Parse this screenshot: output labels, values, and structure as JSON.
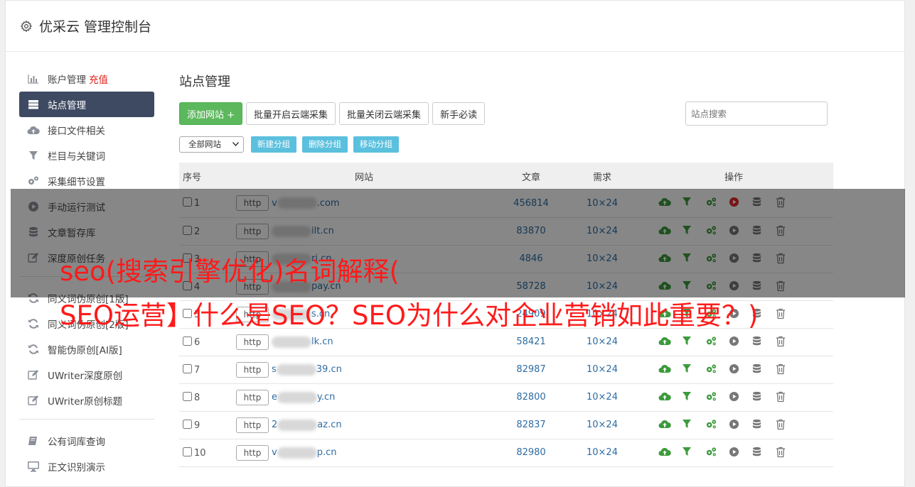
{
  "header": {
    "title": "优采云 管理控制台"
  },
  "sidebar": {
    "items": [
      {
        "label": "账户管理",
        "badge": "充值",
        "icon": "bar-chart-icon"
      },
      {
        "label": "站点管理",
        "icon": "server-icon",
        "active": true
      },
      {
        "label": "接口文件相关",
        "icon": "cloud-upload-icon"
      },
      {
        "label": "栏目与关键词",
        "icon": "filter-icon"
      },
      {
        "label": "采集细节设置",
        "icon": "gears-icon"
      },
      {
        "label": "手动运行测试",
        "icon": "play-circle-icon"
      },
      {
        "label": "文章暂存库",
        "icon": "database-icon"
      },
      {
        "label": "深度原创任务",
        "icon": "edit-icon"
      },
      {
        "label": "同义词伪原创[1版]",
        "icon": "refresh-icon"
      },
      {
        "label": "同义词伪原创[2版]",
        "icon": "refresh-icon"
      },
      {
        "label": "智能伪原创[AI版]",
        "icon": "refresh-icon"
      },
      {
        "label": "UWriter深度原创",
        "icon": "edit-icon"
      },
      {
        "label": "UWriter原创标题",
        "icon": "edit-icon"
      },
      {
        "label": "公有词库查询",
        "icon": "book-icon"
      },
      {
        "label": "正文识别演示",
        "icon": "monitor-icon"
      }
    ]
  },
  "main": {
    "title": "站点管理",
    "buttons": {
      "add": "添加网站 +",
      "enable": "批量开启云端采集",
      "disable": "批量关闭云端采集",
      "guide": "新手必读"
    },
    "search_placeholder": "站点搜索",
    "group_select": "全部网站",
    "group_buttons": {
      "new": "新建分组",
      "delete": "删除分组",
      "move": "移动分组"
    },
    "columns": {
      "no": "序号",
      "site": "网站",
      "articles": "文章",
      "need": "需求",
      "ops": "操作"
    },
    "rows": [
      {
        "no": "1",
        "protocol": "http",
        "prefix": "v",
        "suffix": ".com",
        "articles": "456814",
        "need": "10×24",
        "run_active": true
      },
      {
        "no": "2",
        "protocol": "http",
        "prefix": "",
        "suffix": "ilt.cn",
        "articles": "83870",
        "need": "10×24"
      },
      {
        "no": "3",
        "protocol": "http",
        "prefix": "",
        "suffix": "ri.cn",
        "articles": "4846",
        "need": "10×24"
      },
      {
        "no": "4",
        "protocol": "http",
        "prefix": "",
        "suffix": "pay.cn",
        "articles": "58728",
        "need": "10×24"
      },
      {
        "no": "5",
        "protocol": "http",
        "prefix": "",
        "suffix": "s.cn",
        "articles": "24909",
        "need": "10×24"
      },
      {
        "no": "6",
        "protocol": "http",
        "prefix": "",
        "suffix": "lk.cn",
        "articles": "58421",
        "need": "10×24"
      },
      {
        "no": "7",
        "protocol": "http",
        "prefix": "s",
        "suffix": "39.cn",
        "articles": "82987",
        "need": "10×24"
      },
      {
        "no": "8",
        "protocol": "http",
        "prefix": "e",
        "suffix": "y.cn",
        "articles": "82800",
        "need": "10×24"
      },
      {
        "no": "9",
        "protocol": "http",
        "prefix": "2",
        "suffix": "az.cn",
        "articles": "82837",
        "need": "10×24"
      },
      {
        "no": "10",
        "protocol": "http",
        "prefix": "v",
        "suffix": "p.cn",
        "articles": "82980",
        "need": "10×24"
      }
    ]
  },
  "overlay": {
    "line1": "seo(搜索引擎优化)名词解释(",
    "line2": "SEO运营】什么是SEO？SEO为什么对企业营销如此重要？)"
  },
  "colors": {
    "sidebar_active": "#3e4a62",
    "primary_green": "#5cb85c",
    "info": "#5bc0de",
    "link": "#2d6ca2",
    "overlay_text": "#ff1a1a"
  }
}
